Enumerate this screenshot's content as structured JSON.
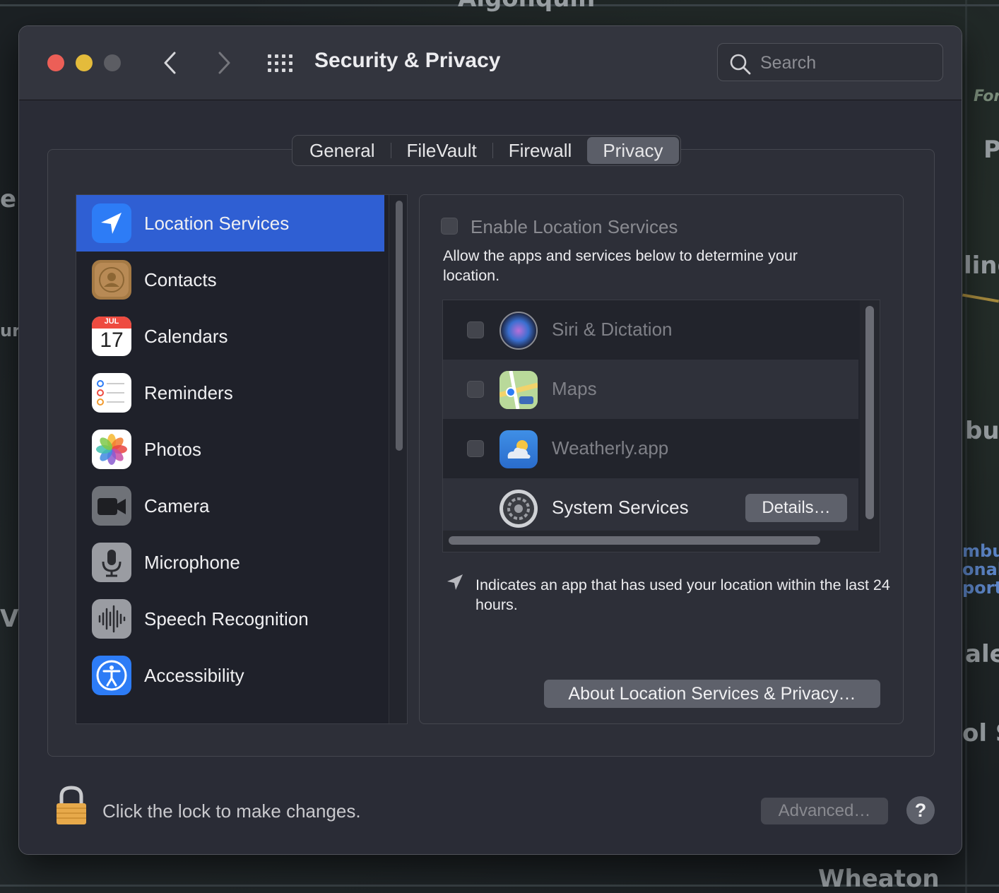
{
  "window": {
    "title": "Security & Privacy"
  },
  "search": {
    "placeholder": "Search"
  },
  "tabs": [
    {
      "label": "General",
      "active": false
    },
    {
      "label": "FileVault",
      "active": false
    },
    {
      "label": "Firewall",
      "active": false
    },
    {
      "label": "Privacy",
      "active": true
    }
  ],
  "sidebar": {
    "items": [
      {
        "label": "Location Services",
        "icon": "location-arrow-icon",
        "selected": true
      },
      {
        "label": "Contacts",
        "icon": "contacts-icon",
        "selected": false
      },
      {
        "label": "Calendars",
        "icon": "calendar-icon",
        "selected": false,
        "icon_month": "JUL",
        "icon_day": "17"
      },
      {
        "label": "Reminders",
        "icon": "reminders-icon",
        "selected": false
      },
      {
        "label": "Photos",
        "icon": "photos-icon",
        "selected": false
      },
      {
        "label": "Camera",
        "icon": "camera-icon",
        "selected": false
      },
      {
        "label": "Microphone",
        "icon": "microphone-icon",
        "selected": false
      },
      {
        "label": "Speech Recognition",
        "icon": "speech-recognition-icon",
        "selected": false
      },
      {
        "label": "Accessibility",
        "icon": "accessibility-icon",
        "selected": false
      }
    ]
  },
  "location": {
    "enable_label": "Enable Location Services",
    "enabled": false,
    "description": "Allow the apps and services below to determine your location.",
    "apps": [
      {
        "name": "Siri & Dictation",
        "icon": "siri-icon",
        "checked": false,
        "enabled": false
      },
      {
        "name": "Maps",
        "icon": "maps-icon",
        "checked": false,
        "enabled": false
      },
      {
        "name": "Weatherly.app",
        "icon": "weather-icon",
        "checked": false,
        "enabled": false
      },
      {
        "name": "System Services",
        "icon": "system-preferences-gear-icon",
        "enabled": true,
        "button": "Details…"
      }
    ],
    "indicator_text": "Indicates an app that has used your location within the last 24 hours.",
    "about_button": "About Location Services & Privacy…"
  },
  "footer": {
    "lock_text": "Click the lock to make changes.",
    "advanced_button": "Advanced…",
    "help_button": "?"
  },
  "desktop": {
    "labels": [
      "Algonquin",
      "For",
      "P",
      "e.",
      "ling",
      "url",
      "bu",
      "mbu",
      "onal",
      "port",
      "V",
      "ale",
      "ol S",
      "Wheaton"
    ]
  },
  "colors": {
    "accent": "#2f5fd3",
    "window_bg": "#2a2c36",
    "close": "#ec5f57",
    "minimize": "#e4bb3b"
  }
}
